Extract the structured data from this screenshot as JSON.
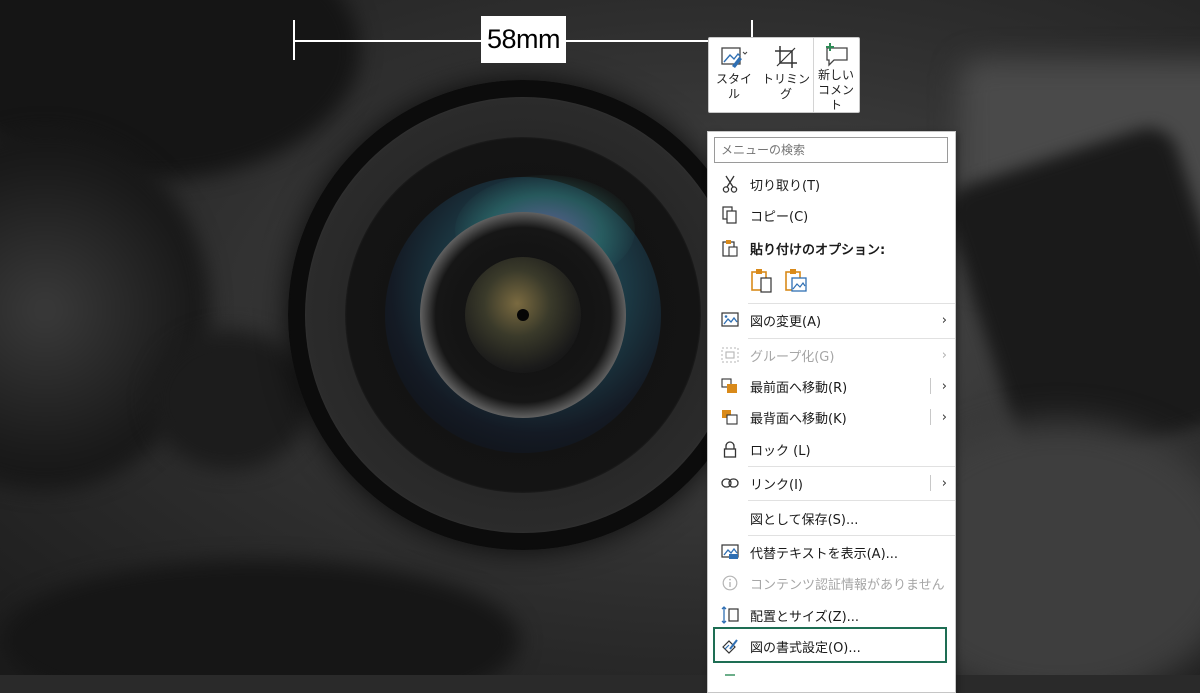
{
  "annotation": {
    "dimension_label": "58mm"
  },
  "mini_toolbar": {
    "style_label": "スタイ\nル",
    "crop_label": "トリミング",
    "comment_label": "新しい\nコメント"
  },
  "context_menu": {
    "search_placeholder": "メニューの検索",
    "cut": "切り取り(T)",
    "copy": "コピー(C)",
    "paste_header": "貼り付けのオプション:",
    "change_picture": "図の変更(A)",
    "group": "グループ化(G)",
    "bring_front": "最前面へ移動(R)",
    "send_back": "最背面へ移動(K)",
    "lock": "ロック (L)",
    "link": "リンク(I)",
    "save_as_picture": "図として保存(S)...",
    "alt_text": "代替テキストを表示(A)...",
    "content_credentials": "コンテンツ認証情報がありません",
    "size_position": "配置とサイズ(Z)...",
    "format_picture": "図の書式設定(O)...",
    "arrow": "›"
  },
  "colors": {
    "highlight_border": "#1e6e54",
    "icon_orange": "#d98a1a",
    "icon_blue": "#2f6fb3",
    "icon_green": "#2e8b57"
  }
}
